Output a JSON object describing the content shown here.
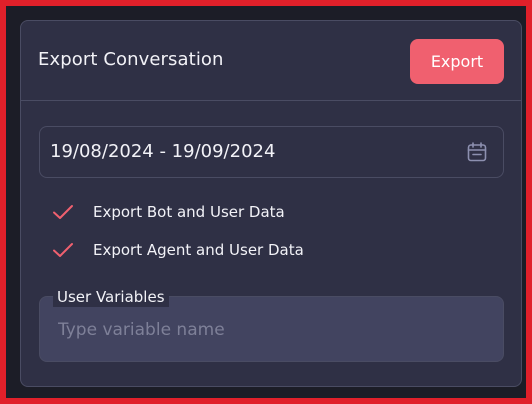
{
  "panel": {
    "title": "Export Conversation",
    "export_button_label": "Export"
  },
  "date_range": {
    "value": "19/08/2024 - 19/09/2024",
    "icon": "calendar-icon"
  },
  "options": [
    {
      "label": "Export Bot and User Data",
      "checked": true,
      "icon": "check-icon"
    },
    {
      "label": "Export Agent and User Data",
      "checked": true,
      "icon": "check-icon"
    }
  ],
  "user_variables": {
    "legend": "User Variables",
    "placeholder": "Type variable name",
    "value": ""
  },
  "colors": {
    "accent": "#f0606f",
    "panel_bg": "#2f3045",
    "input_bg": "#424460",
    "border": "#4a4c63",
    "highlight_frame": "#e0202a"
  }
}
